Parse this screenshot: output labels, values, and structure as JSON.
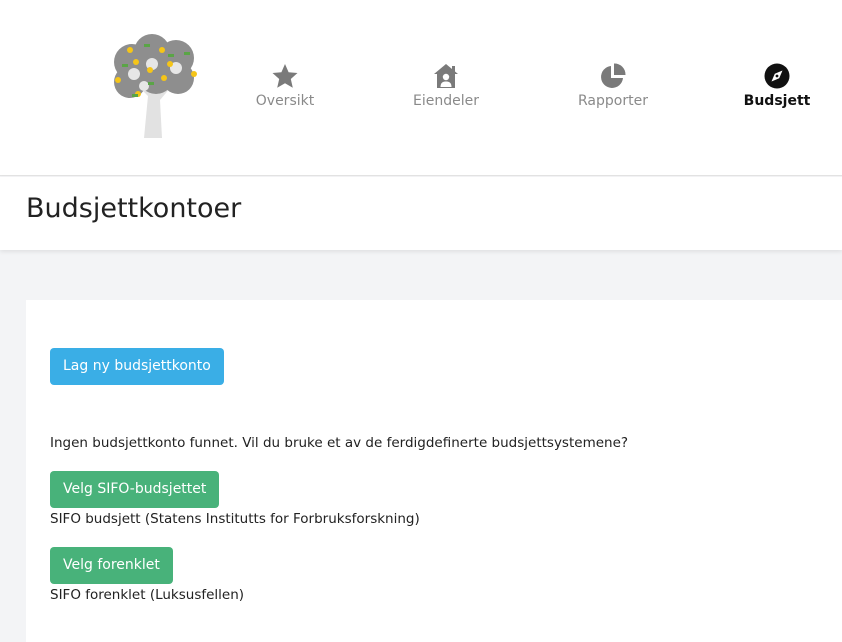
{
  "nav": {
    "items": [
      {
        "label": "Oversikt",
        "icon": "star-icon",
        "active": false
      },
      {
        "label": "Eiendeler",
        "icon": "house-person-icon",
        "active": false
      },
      {
        "label": "Rapporter",
        "icon": "pie-chart-icon",
        "active": false
      },
      {
        "label": "Budsjett",
        "icon": "compass-icon",
        "active": true
      }
    ]
  },
  "logo": {
    "icon": "tree-logo-icon"
  },
  "page": {
    "title": "Budsjettkontoer"
  },
  "content": {
    "new_account_button": "Lag ny budsjettkonto",
    "no_account_message": "Ingen budsjettkonto funnet. Vil du bruke et av de ferdigdefinerte budsjettsystemene?",
    "sifo_button": "Velg SIFO-budsjettet",
    "sifo_description": "SIFO budsjett (Statens Institutts for Forbruksforskning)",
    "simple_button": "Velg forenklet",
    "simple_description": "SIFO forenklet (Luksusfellen)"
  },
  "colors": {
    "primary_button": "#3aaee6",
    "success_button": "#48b27a",
    "nav_inactive": "#8a8a8a",
    "nav_active": "#111111"
  }
}
